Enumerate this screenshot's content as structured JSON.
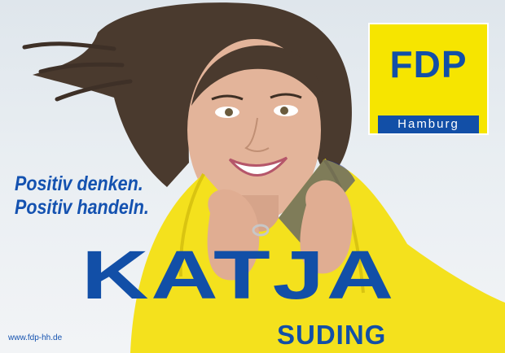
{
  "logo": {
    "party": "FDP",
    "region": "Hamburg"
  },
  "slogan": {
    "line1": "Positiv denken.",
    "line2": "Positiv handeln."
  },
  "candidate": {
    "first_name": "KATJA",
    "last_name": "SUDING"
  },
  "website": "www.fdp-hh.de",
  "colors": {
    "brand_blue": "#124fa7",
    "brand_yellow": "#f6e500",
    "background": "#e6ebf0"
  }
}
